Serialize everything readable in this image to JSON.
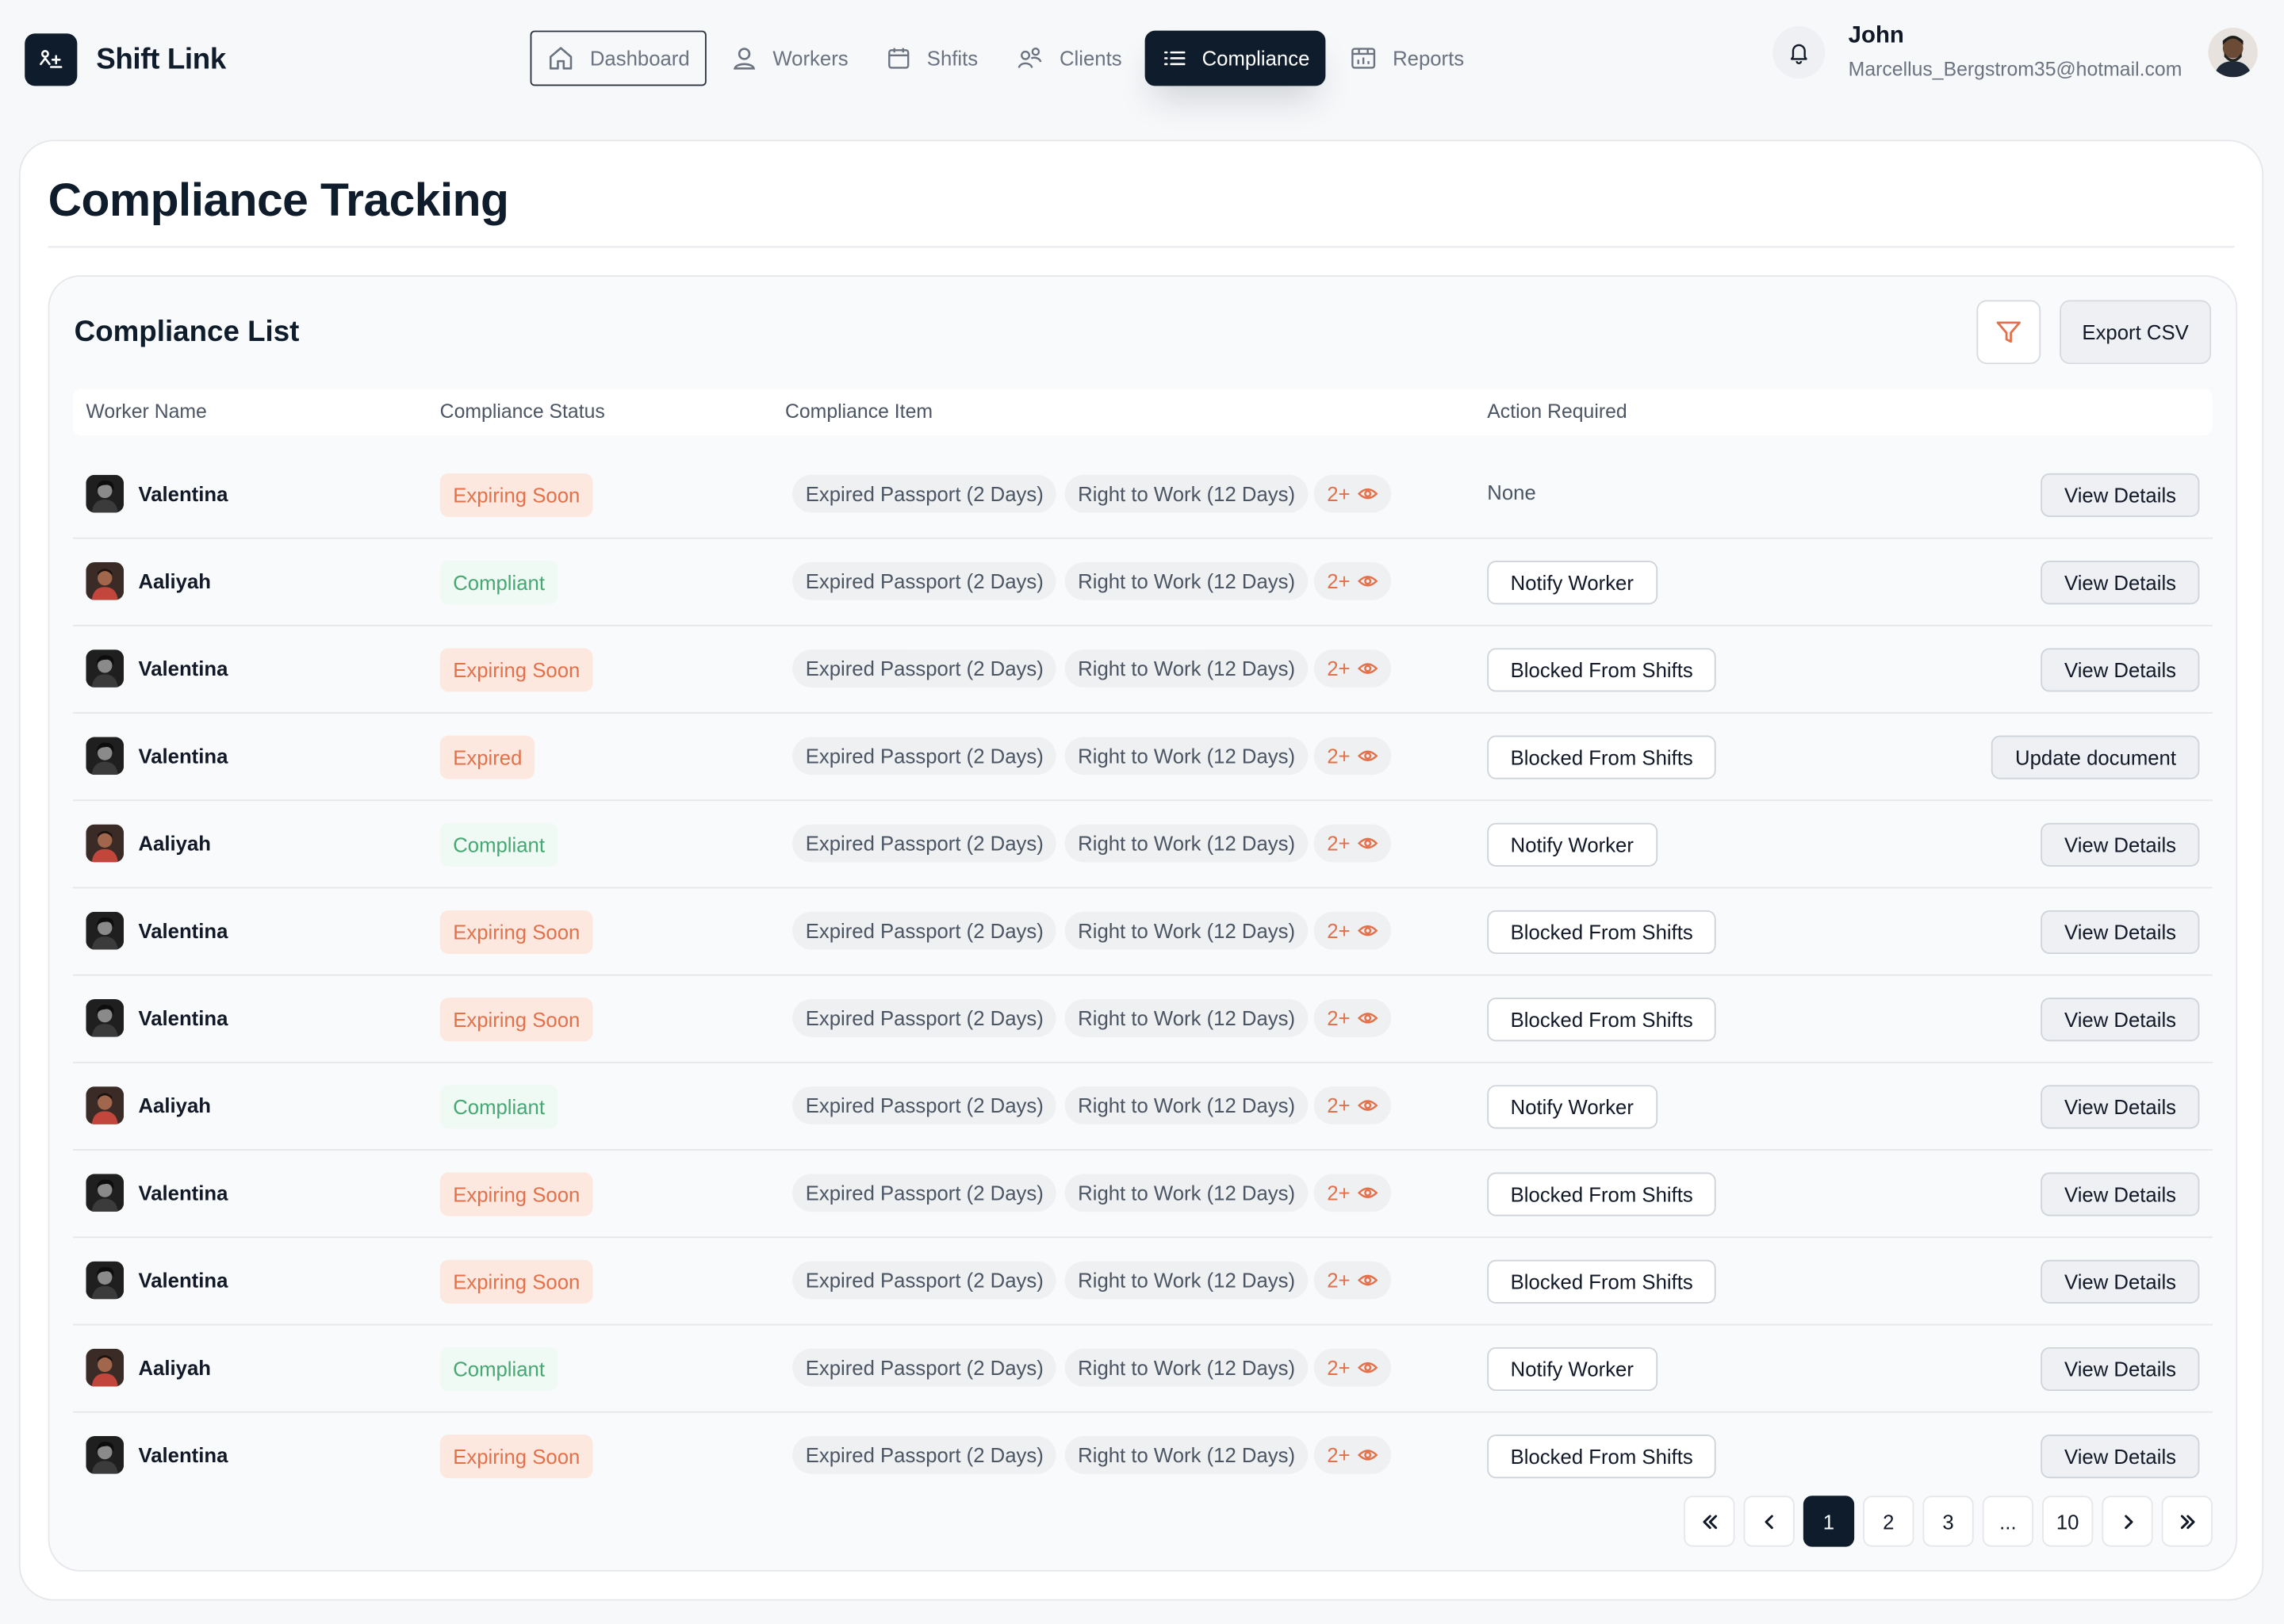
{
  "app": {
    "name": "Shift Link"
  },
  "nav": {
    "items": [
      {
        "label": "Dashboard",
        "icon": "home-icon"
      },
      {
        "label": "Workers",
        "icon": "user-icon"
      },
      {
        "label": "Shfits",
        "icon": "calendar-icon"
      },
      {
        "label": "Clients",
        "icon": "clients-icon"
      },
      {
        "label": "Compliance",
        "icon": "list-icon",
        "active": true
      },
      {
        "label": "Reports",
        "icon": "reports-icon"
      }
    ]
  },
  "user": {
    "name": "John",
    "email": "Marcellus_Bergstrom35@hotmail.com"
  },
  "page": {
    "title": "Compliance Tracking"
  },
  "panel": {
    "title": "Compliance List",
    "export_label": "Export CSV",
    "columns": [
      "Worker Name",
      "Compliance Status",
      "Compliance Item",
      "Action Required"
    ]
  },
  "rows": [
    {
      "name": "Valentina",
      "status": "Expiring Soon",
      "item1": "Expired Passport (2 Days)",
      "item2": "Right to Work (12 Days)",
      "more": "2+",
      "action": "None",
      "detail": "View Details"
    },
    {
      "name": "Aaliyah",
      "status": "Compliant",
      "item1": "Expired Passport (2 Days)",
      "item2": "Right to Work (12 Days)",
      "more": "2+",
      "action": "Notify Worker",
      "detail": "View Details"
    },
    {
      "name": "Valentina",
      "status": "Expiring Soon",
      "item1": "Expired Passport (2 Days)",
      "item2": "Right to Work (12 Days)",
      "more": "2+",
      "action": "Blocked From Shifts",
      "detail": "View Details"
    },
    {
      "name": "Valentina",
      "status": "Expired",
      "item1": "Expired Passport (2 Days)",
      "item2": "Right to Work (12 Days)",
      "more": "2+",
      "action": "Blocked From Shifts",
      "detail": "Update document"
    },
    {
      "name": "Aaliyah",
      "status": "Compliant",
      "item1": "Expired Passport (2 Days)",
      "item2": "Right to Work (12 Days)",
      "more": "2+",
      "action": "Notify Worker",
      "detail": "View Details"
    },
    {
      "name": "Valentina",
      "status": "Expiring Soon",
      "item1": "Expired Passport (2 Days)",
      "item2": "Right to Work (12 Days)",
      "more": "2+",
      "action": "Blocked From Shifts",
      "detail": "View Details"
    },
    {
      "name": "Valentina",
      "status": "Expiring Soon",
      "item1": "Expired Passport (2 Days)",
      "item2": "Right to Work (12 Days)",
      "more": "2+",
      "action": "Blocked From Shifts",
      "detail": "View Details"
    },
    {
      "name": "Aaliyah",
      "status": "Compliant",
      "item1": "Expired Passport (2 Days)",
      "item2": "Right to Work (12 Days)",
      "more": "2+",
      "action": "Notify Worker",
      "detail": "View Details"
    },
    {
      "name": "Valentina",
      "status": "Expiring Soon",
      "item1": "Expired Passport (2 Days)",
      "item2": "Right to Work (12 Days)",
      "more": "2+",
      "action": "Blocked From Shifts",
      "detail": "View Details"
    },
    {
      "name": "Valentina",
      "status": "Expiring Soon",
      "item1": "Expired Passport (2 Days)",
      "item2": "Right to Work (12 Days)",
      "more": "2+",
      "action": "Blocked From Shifts",
      "detail": "View Details"
    },
    {
      "name": "Aaliyah",
      "status": "Compliant",
      "item1": "Expired Passport (2 Days)",
      "item2": "Right to Work (12 Days)",
      "more": "2+",
      "action": "Notify Worker",
      "detail": "View Details"
    },
    {
      "name": "Valentina",
      "status": "Expiring Soon",
      "item1": "Expired Passport (2 Days)",
      "item2": "Right to Work (12 Days)",
      "more": "2+",
      "action": "Blocked From Shifts",
      "detail": "View Details"
    }
  ],
  "pagination": {
    "pages": [
      "1",
      "2",
      "3",
      "...",
      "10"
    ],
    "current": "1"
  },
  "colors": {
    "primary": "#0f1c2b",
    "warning": "#e4704a",
    "success": "#45a872"
  }
}
